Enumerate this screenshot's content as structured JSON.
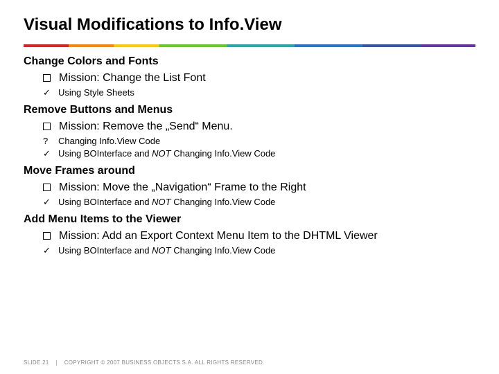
{
  "title": "Visual Modifications to Info.View",
  "sections": [
    {
      "heading": "Change Colors and Fonts",
      "mission": "Mission: Change the List Font",
      "subs": [
        {
          "icon": "✓",
          "text": "Using Style Sheets"
        }
      ]
    },
    {
      "heading": "Remove Buttons and Menus",
      "mission": "Mission: Remove the „Send“ Menu.",
      "subs": [
        {
          "icon": "?",
          "text": "Changing Info.View Code"
        },
        {
          "icon": "✓",
          "text_html": "Using BOInterface and <i>NOT</i> Changing Info.View Code"
        }
      ]
    },
    {
      "heading": "Move Frames around",
      "mission": "Mission: Move the „Navigation“ Frame to the Right",
      "subs": [
        {
          "icon": "✓",
          "text_html": "Using BOInterface and <i>NOT</i> Changing Info.View Code"
        }
      ]
    },
    {
      "heading": "Add Menu Items to the Viewer",
      "mission": "Mission: Add an Export Context Menu Item to the DHTML Viewer",
      "subs": [
        {
          "icon": "✓",
          "text_html": "Using BOInterface and <i>NOT</i> Changing Info.View Code"
        }
      ]
    }
  ],
  "footer": {
    "slide": "SLIDE 21",
    "copyright": "COPYRIGHT © 2007 BUSINESS OBJECTS S.A. ALL RIGHTS RESERVED."
  }
}
